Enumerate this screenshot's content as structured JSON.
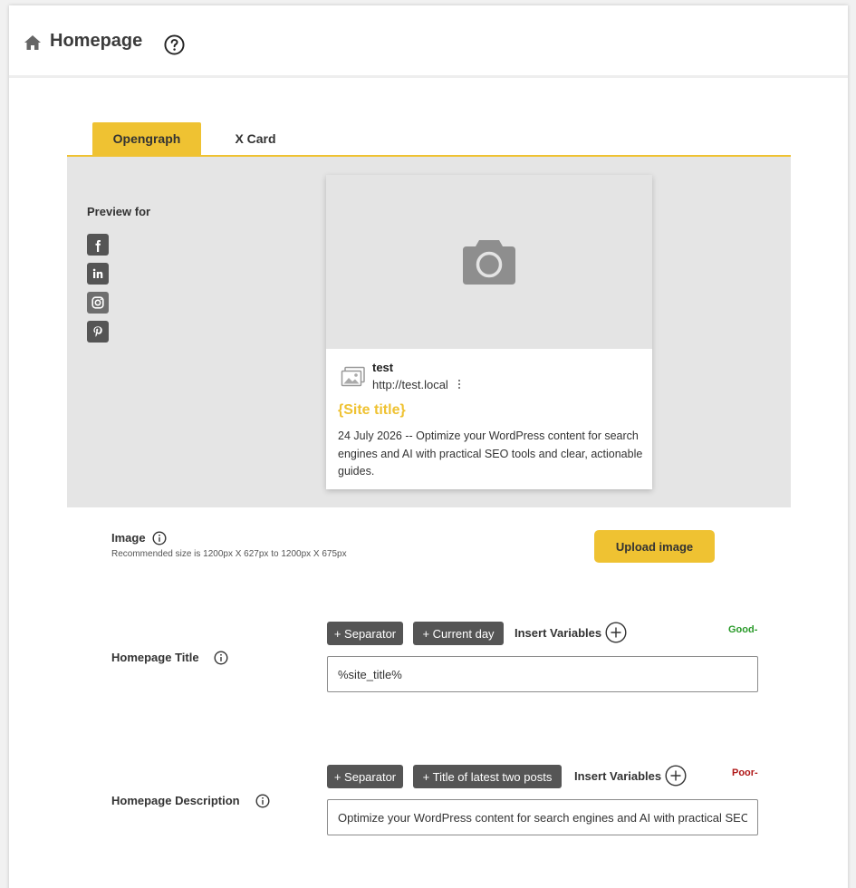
{
  "header": {
    "title": "Homepage",
    "home_icon": "home-icon",
    "help_icon": "help-circle-icon"
  },
  "tabs": [
    {
      "label": "Opengraph",
      "active": true
    },
    {
      "label": "X Card",
      "active": false
    }
  ],
  "preview": {
    "preview_for_label": "Preview for",
    "social_icons": [
      "facebook-icon",
      "linkedin-icon",
      "instagram-icon",
      "pinterest-icon"
    ],
    "card": {
      "site_name": "test",
      "site_url": "http://test.local",
      "title": "{Site title}",
      "description": "24 July 2026 -- Optimize your WordPress content for search engines and AI with practical SEO tools and clear, actionable guides."
    }
  },
  "image_section": {
    "label": "Image",
    "hint": "Recommended size is 1200px X 627px to 1200px X 675px",
    "upload_label": "Upload image"
  },
  "homepage_title": {
    "label": "Homepage Title",
    "chips": [
      "+ Separator",
      "+ Current day"
    ],
    "insert_label": "Insert Variables",
    "status": "Good-",
    "value": "%site_title%"
  },
  "homepage_description": {
    "label": "Homepage Description",
    "chips": [
      "+ Separator",
      "+ Title of latest two posts"
    ],
    "insert_label": "Insert Variables",
    "status": "Poor-",
    "value": "Optimize your WordPress content for search engines and AI with practical SEO"
  },
  "colors": {
    "accent": "#efc232",
    "chip": "#555555",
    "good": "#2a9a2a",
    "poor": "#b01818"
  }
}
